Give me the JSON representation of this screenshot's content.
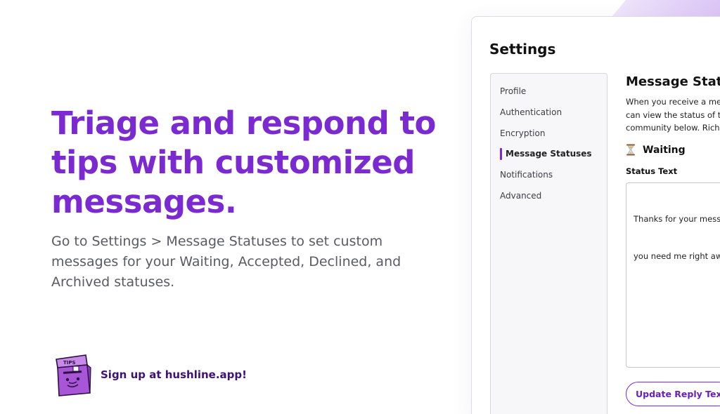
{
  "hero": {
    "headline": "Triage and respond to tips with customized messages.",
    "subtext": "Go to Settings > Message Statuses to set custom messages for your Waiting, Accepted, Declined, and Archived statuses."
  },
  "signup": {
    "label": "Sign up at hushline.app!",
    "logo_text": "TIPS"
  },
  "settings": {
    "title": "Settings",
    "nav": [
      {
        "label": "Profile"
      },
      {
        "label": "Authentication"
      },
      {
        "label": "Encryption"
      },
      {
        "label": "Message Statuses",
        "active": true
      },
      {
        "label": "Notifications"
      },
      {
        "label": "Advanced"
      }
    ],
    "section_title": "Message Statu",
    "description_lines": [
      "When you receive a me",
      "can view the status of t",
      "community below. Rich"
    ],
    "waiting_label": "Waiting",
    "status_text_label": "Status Text",
    "status_text_value_lines": [
      "Thanks for your mess",
      "you need me right aw"
    ],
    "update_button": "Update Reply Text"
  },
  "colors": {
    "accent": "#7a2ad0",
    "headline": "#7a2ad0",
    "signup_text": "#3e1270",
    "body_text": "#5a5a64"
  },
  "icons": {
    "tips_box": "tips-box-mascot-icon",
    "waiting": "hourglass-icon"
  }
}
